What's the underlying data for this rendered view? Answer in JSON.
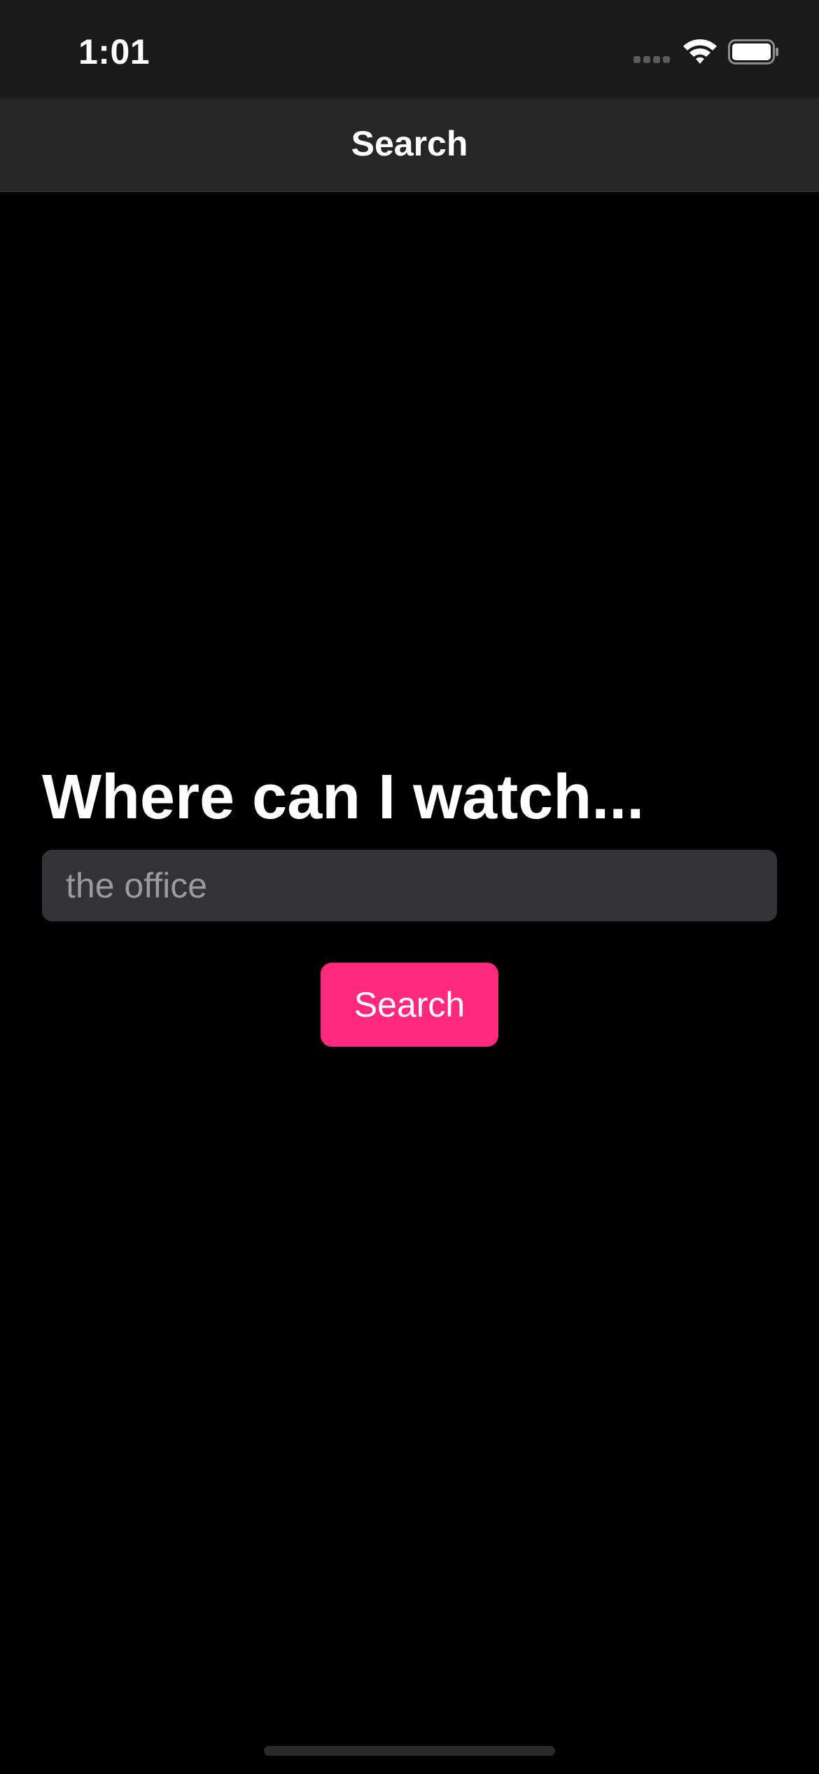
{
  "status_bar": {
    "time": "1:01",
    "icons": [
      "signal-icon",
      "wifi-icon",
      "battery-icon"
    ]
  },
  "nav": {
    "title": "Search"
  },
  "main": {
    "heading": "Where can I watch...",
    "search_placeholder": "the office",
    "search_value": "",
    "search_button_label": "Search"
  },
  "colors": {
    "background": "#000000",
    "status_bar": "#1a1a1a",
    "nav_bar": "#262626",
    "input_background": "#333337",
    "accent": "#ff2a7f"
  }
}
